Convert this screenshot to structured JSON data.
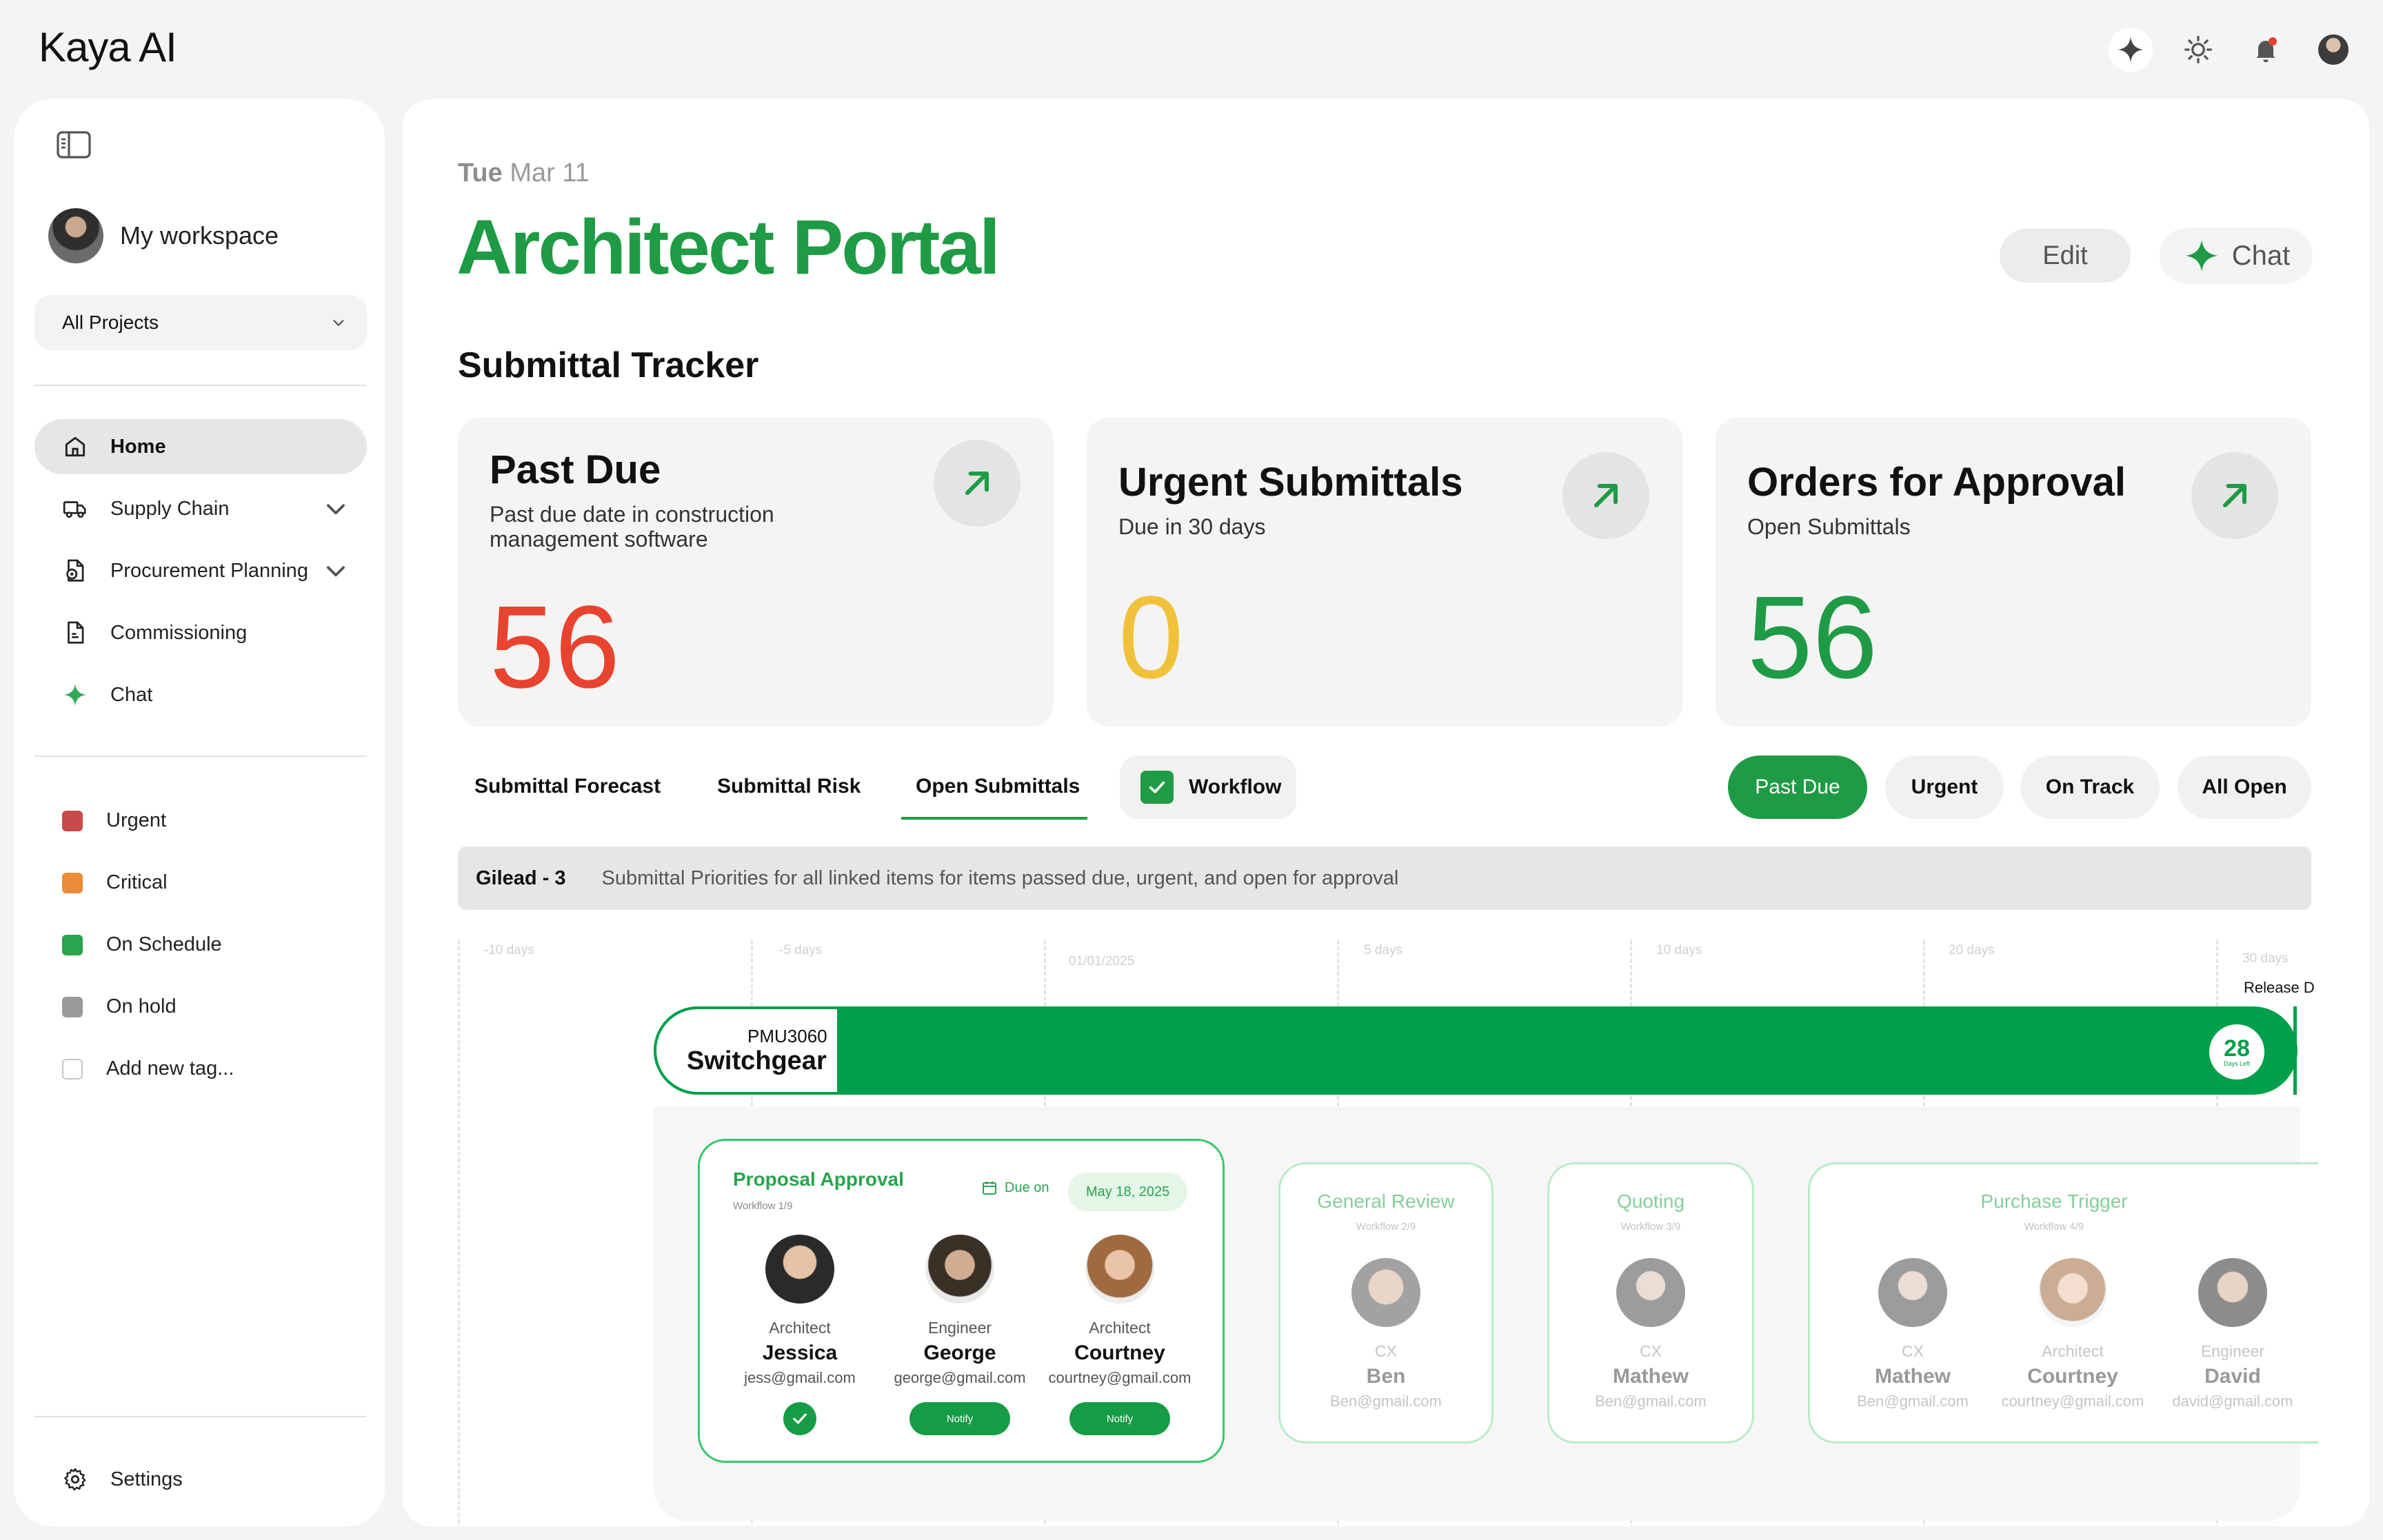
{
  "app": {
    "logo": "Kaya AI"
  },
  "topbar": {
    "icons": [
      "sparkle-icon",
      "sun-icon",
      "bell-icon",
      "avatar"
    ]
  },
  "sidebar": {
    "workspace": "My workspace",
    "project_select": "All Projects",
    "nav": [
      {
        "label": "Home",
        "icon": "home-icon",
        "active": true
      },
      {
        "label": "Supply Chain",
        "icon": "truck-icon",
        "expandable": true
      },
      {
        "label": "Procurement Planning",
        "icon": "doc-gear-icon",
        "expandable": true
      },
      {
        "label": "Commissioning",
        "icon": "doc-icon"
      },
      {
        "label": "Chat",
        "icon": "sparkle-icon"
      }
    ],
    "tags": [
      {
        "label": "Urgent",
        "color": "#c94a4a"
      },
      {
        "label": "Critical",
        "color": "#ea8c3a"
      },
      {
        "label": "On Schedule",
        "color": "#2aa44f"
      },
      {
        "label": "On hold",
        "color": "#9a9a9a"
      },
      {
        "label": "Add new tag...",
        "color": "#ffffff"
      }
    ],
    "settings": "Settings"
  },
  "main": {
    "date_day": "Tue",
    "date_rest": "Mar 11",
    "title": "Architect Portal",
    "edit_label": "Edit",
    "chat_label": "Chat",
    "section_title": "Submittal Tracker",
    "cards": [
      {
        "title": "Past Due",
        "subtitle": "Past due date in construction management software",
        "value": "56",
        "color": "#e8432e"
      },
      {
        "title": "Urgent Submittals",
        "subtitle": "Due in 30 days",
        "value": "0",
        "color": "#f0c23a"
      },
      {
        "title": "Orders for Approval",
        "subtitle": "Open Submittals",
        "value": "56",
        "color": "#1f9b45"
      }
    ],
    "tabs": [
      "Submittal Forecast",
      "Submittal Risk",
      "Open Submittals"
    ],
    "active_tab": "Open Submittals",
    "workflow_toggle": {
      "label": "Workflow",
      "checked": true
    },
    "filters": [
      "Past Due",
      "Urgent",
      "On Track",
      "All Open"
    ],
    "active_filter": "Past Due",
    "banner": {
      "project": "Gilead - 3",
      "text": "Submittal Priorities for all linked items for items passed due, urgent, and open for approval"
    }
  },
  "timeline": {
    "ticks": [
      "-10 days",
      "-5 days",
      "01/01/2025",
      "5 days",
      "10 days",
      "20 days",
      "30 days"
    ],
    "release_label": "Release D",
    "item": {
      "code": "PMU3060",
      "name": "Switchgear",
      "days_left": "28",
      "days_left_label": "Days Left"
    },
    "workflows": [
      {
        "title": "Proposal Approval",
        "step": "Workflow 1/9",
        "due_label": "Due on",
        "due_date": "May 18, 2025",
        "active": true,
        "people": [
          {
            "role": "Architect",
            "name": "Jessica",
            "email": "jess@gmail.com",
            "action": "done"
          },
          {
            "role": "Engineer",
            "name": "George",
            "email": "george@gmail.com",
            "action": "Notify"
          },
          {
            "role": "Architect",
            "name": "Courtney",
            "email": "courtney@gmail.com",
            "action": "Notify"
          }
        ]
      },
      {
        "title": "General Review",
        "step": "Workflow 2/9",
        "people": [
          {
            "role": "CX",
            "name": "Ben",
            "email": "Ben@gmail.com"
          }
        ]
      },
      {
        "title": "Quoting",
        "step": "Workflow 3/9",
        "people": [
          {
            "role": "CX",
            "name": "Mathew",
            "email": "Ben@gmail.com"
          }
        ]
      },
      {
        "title": "Purchase Trigger",
        "step": "Workflow 4/9",
        "people": [
          {
            "role": "CX",
            "name": "Mathew",
            "email": "Ben@gmail.com"
          },
          {
            "role": "Architect",
            "name": "Courtney",
            "email": "courtney@gmail.com"
          },
          {
            "role": "Engineer",
            "name": "David",
            "email": "david@gmail.com"
          }
        ]
      }
    ]
  }
}
